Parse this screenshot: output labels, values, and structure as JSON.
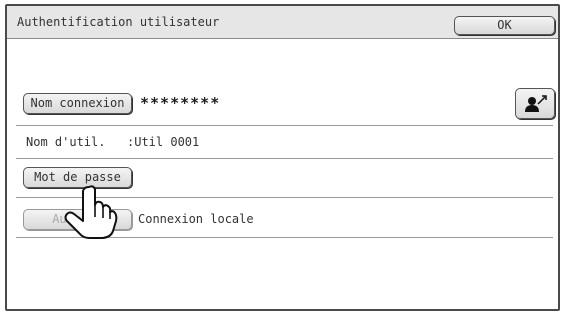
{
  "header": {
    "title": "Authentification utilisateur",
    "ok_label": "OK"
  },
  "login": {
    "button_label": "Nom connexion",
    "value": "********"
  },
  "user_info": {
    "label": "Nom d'util.",
    "value": ":Util 0001"
  },
  "password": {
    "button_label": "Mot de passe"
  },
  "auth": {
    "button_label": "Auth. à",
    "value": "Connexion locale"
  },
  "icons": {
    "user_select": "user-select-icon",
    "pointer": "hand-pointer-icon"
  }
}
